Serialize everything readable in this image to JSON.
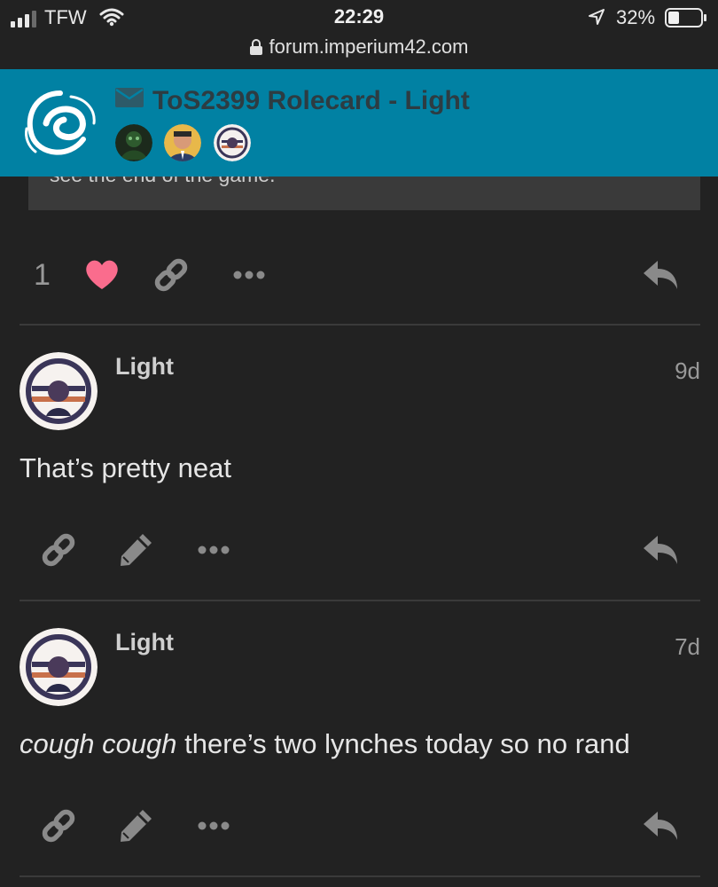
{
  "status_bar": {
    "carrier": "TFW",
    "time": "22:29",
    "battery": "32%",
    "url": "forum.imperium42.com"
  },
  "header": {
    "title": "ToS2399 Rolecard - Light",
    "participants": [
      "participant-1-avatar",
      "participant-2-avatar",
      "participant-3-avatar"
    ]
  },
  "previous_post": {
    "quote_tail": "see the end of the game.",
    "like_count": "1"
  },
  "posts": [
    {
      "username": "Light",
      "age": "9d",
      "body": "That’s pretty neat"
    },
    {
      "username": "Light",
      "age": "7d",
      "body_emphasis": "cough cough",
      "body": " there’s two lynches today so no rand"
    }
  ],
  "colors": {
    "header_bg": "#0181a3",
    "page_bg": "#222222",
    "like_heart": "#fa6c8d",
    "title_text": "#2d3c42"
  },
  "icons": [
    "signal-icon",
    "wifi-icon",
    "location-icon",
    "battery-icon",
    "lock-icon",
    "envelope-icon",
    "heart-icon",
    "link-icon",
    "more-icon",
    "reply-icon",
    "edit-icon"
  ]
}
